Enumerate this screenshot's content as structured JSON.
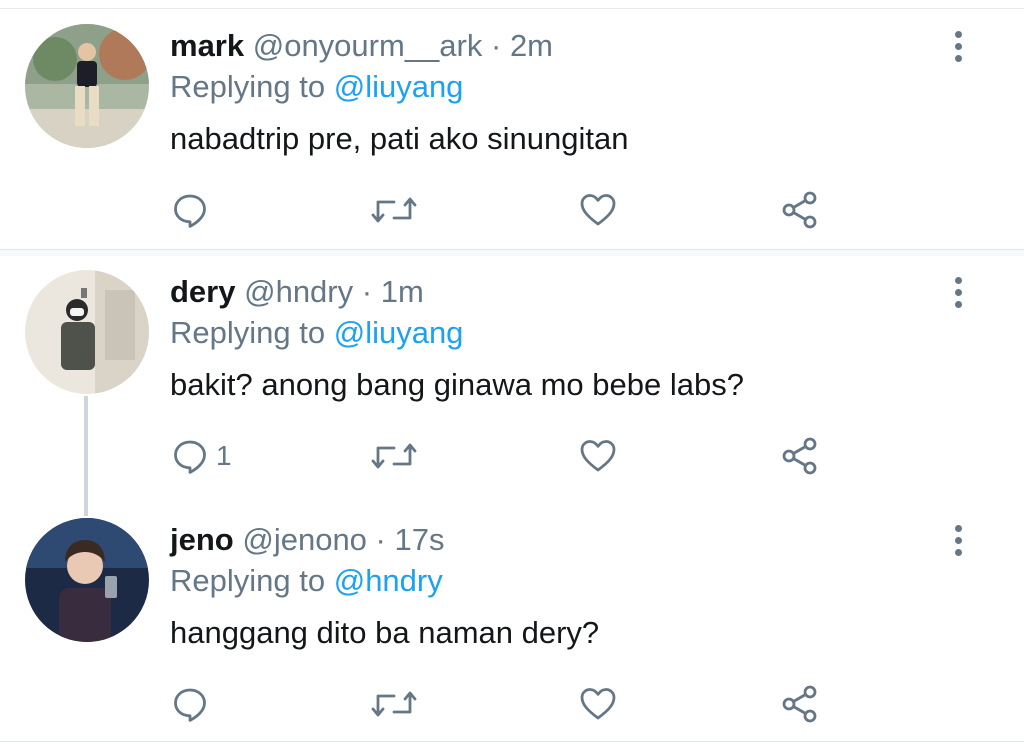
{
  "tweets": [
    {
      "name": "mark",
      "handle": "@onyourm__ark",
      "time": "2m",
      "replying_prefix": "Replying to",
      "replying_to": "@liuyang",
      "text": "nabadtrip pre, pati ako sinungitan",
      "reply_count": "",
      "avatar_colors": [
        "#7c8f7a",
        "#d9c9b0"
      ]
    },
    {
      "name": "dery",
      "handle": "@hndry",
      "time": "1m",
      "replying_prefix": "Replying to",
      "replying_to": "@liuyang",
      "text": "bakit? anong bang ginawa mo bebe labs?",
      "reply_count": "1",
      "avatar_colors": [
        "#e8e2d8",
        "#4a4a44"
      ]
    },
    {
      "name": "jeno",
      "handle": "@jenono",
      "time": "17s",
      "replying_prefix": "Replying to",
      "replying_to": "@hndry",
      "text": "hanggang dito ba naman dery?",
      "reply_count": "",
      "avatar_colors": [
        "#1f2f4d",
        "#e9c9b3"
      ]
    }
  ],
  "separator": "·",
  "icons": {
    "reply": "reply-icon",
    "retweet": "retweet-icon",
    "like": "like-icon",
    "share": "share-icon",
    "more": "more-vertical-icon"
  },
  "colors": {
    "text_primary": "#14171a",
    "text_secondary": "#657786",
    "link": "#1da1f2"
  }
}
